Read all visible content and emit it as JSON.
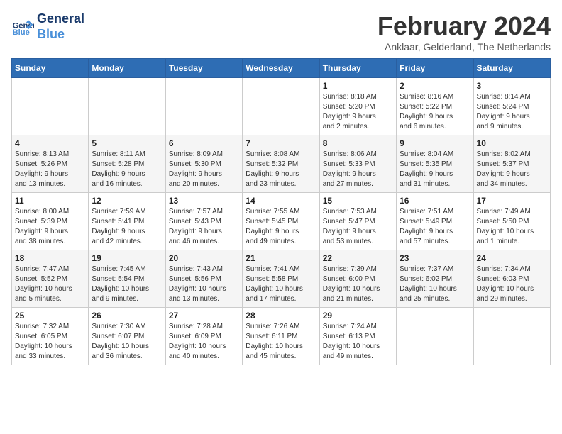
{
  "header": {
    "logo_line1": "General",
    "logo_line2": "Blue",
    "title": "February 2024",
    "subtitle": "Anklaar, Gelderland, The Netherlands"
  },
  "weekdays": [
    "Sunday",
    "Monday",
    "Tuesday",
    "Wednesday",
    "Thursday",
    "Friday",
    "Saturday"
  ],
  "weeks": [
    [
      {
        "day": "",
        "info": ""
      },
      {
        "day": "",
        "info": ""
      },
      {
        "day": "",
        "info": ""
      },
      {
        "day": "",
        "info": ""
      },
      {
        "day": "1",
        "info": "Sunrise: 8:18 AM\nSunset: 5:20 PM\nDaylight: 9 hours\nand 2 minutes."
      },
      {
        "day": "2",
        "info": "Sunrise: 8:16 AM\nSunset: 5:22 PM\nDaylight: 9 hours\nand 6 minutes."
      },
      {
        "day": "3",
        "info": "Sunrise: 8:14 AM\nSunset: 5:24 PM\nDaylight: 9 hours\nand 9 minutes."
      }
    ],
    [
      {
        "day": "4",
        "info": "Sunrise: 8:13 AM\nSunset: 5:26 PM\nDaylight: 9 hours\nand 13 minutes."
      },
      {
        "day": "5",
        "info": "Sunrise: 8:11 AM\nSunset: 5:28 PM\nDaylight: 9 hours\nand 16 minutes."
      },
      {
        "day": "6",
        "info": "Sunrise: 8:09 AM\nSunset: 5:30 PM\nDaylight: 9 hours\nand 20 minutes."
      },
      {
        "day": "7",
        "info": "Sunrise: 8:08 AM\nSunset: 5:32 PM\nDaylight: 9 hours\nand 23 minutes."
      },
      {
        "day": "8",
        "info": "Sunrise: 8:06 AM\nSunset: 5:33 PM\nDaylight: 9 hours\nand 27 minutes."
      },
      {
        "day": "9",
        "info": "Sunrise: 8:04 AM\nSunset: 5:35 PM\nDaylight: 9 hours\nand 31 minutes."
      },
      {
        "day": "10",
        "info": "Sunrise: 8:02 AM\nSunset: 5:37 PM\nDaylight: 9 hours\nand 34 minutes."
      }
    ],
    [
      {
        "day": "11",
        "info": "Sunrise: 8:00 AM\nSunset: 5:39 PM\nDaylight: 9 hours\nand 38 minutes."
      },
      {
        "day": "12",
        "info": "Sunrise: 7:59 AM\nSunset: 5:41 PM\nDaylight: 9 hours\nand 42 minutes."
      },
      {
        "day": "13",
        "info": "Sunrise: 7:57 AM\nSunset: 5:43 PM\nDaylight: 9 hours\nand 46 minutes."
      },
      {
        "day": "14",
        "info": "Sunrise: 7:55 AM\nSunset: 5:45 PM\nDaylight: 9 hours\nand 49 minutes."
      },
      {
        "day": "15",
        "info": "Sunrise: 7:53 AM\nSunset: 5:47 PM\nDaylight: 9 hours\nand 53 minutes."
      },
      {
        "day": "16",
        "info": "Sunrise: 7:51 AM\nSunset: 5:49 PM\nDaylight: 9 hours\nand 57 minutes."
      },
      {
        "day": "17",
        "info": "Sunrise: 7:49 AM\nSunset: 5:50 PM\nDaylight: 10 hours\nand 1 minute."
      }
    ],
    [
      {
        "day": "18",
        "info": "Sunrise: 7:47 AM\nSunset: 5:52 PM\nDaylight: 10 hours\nand 5 minutes."
      },
      {
        "day": "19",
        "info": "Sunrise: 7:45 AM\nSunset: 5:54 PM\nDaylight: 10 hours\nand 9 minutes."
      },
      {
        "day": "20",
        "info": "Sunrise: 7:43 AM\nSunset: 5:56 PM\nDaylight: 10 hours\nand 13 minutes."
      },
      {
        "day": "21",
        "info": "Sunrise: 7:41 AM\nSunset: 5:58 PM\nDaylight: 10 hours\nand 17 minutes."
      },
      {
        "day": "22",
        "info": "Sunrise: 7:39 AM\nSunset: 6:00 PM\nDaylight: 10 hours\nand 21 minutes."
      },
      {
        "day": "23",
        "info": "Sunrise: 7:37 AM\nSunset: 6:02 PM\nDaylight: 10 hours\nand 25 minutes."
      },
      {
        "day": "24",
        "info": "Sunrise: 7:34 AM\nSunset: 6:03 PM\nDaylight: 10 hours\nand 29 minutes."
      }
    ],
    [
      {
        "day": "25",
        "info": "Sunrise: 7:32 AM\nSunset: 6:05 PM\nDaylight: 10 hours\nand 33 minutes."
      },
      {
        "day": "26",
        "info": "Sunrise: 7:30 AM\nSunset: 6:07 PM\nDaylight: 10 hours\nand 36 minutes."
      },
      {
        "day": "27",
        "info": "Sunrise: 7:28 AM\nSunset: 6:09 PM\nDaylight: 10 hours\nand 40 minutes."
      },
      {
        "day": "28",
        "info": "Sunrise: 7:26 AM\nSunset: 6:11 PM\nDaylight: 10 hours\nand 45 minutes."
      },
      {
        "day": "29",
        "info": "Sunrise: 7:24 AM\nSunset: 6:13 PM\nDaylight: 10 hours\nand 49 minutes."
      },
      {
        "day": "",
        "info": ""
      },
      {
        "day": "",
        "info": ""
      }
    ]
  ]
}
